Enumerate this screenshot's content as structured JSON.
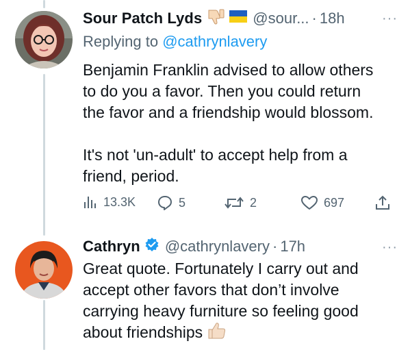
{
  "tweets": [
    {
      "author_name": "Sour Patch Lyds",
      "author_emoji": "👎",
      "author_flag": "🇺🇦",
      "handle": "@sour...",
      "separator": "·",
      "time": "18h",
      "more": "···",
      "replying_prefix": "Replying to",
      "replying_to": "@cathrynlavery",
      "text": "Benjamin Franklin advised to allow others\nto do you a favor. Then you could return\nthe favor and a friendship would blossom.\n\nIt's not 'un-adult' to accept help from a\nfriend, period.",
      "actions": {
        "views": "13.3K",
        "replies": "5",
        "retweets": "2",
        "likes": "697"
      }
    },
    {
      "author_name": "Cathryn",
      "verified": true,
      "handle": "@cathrynlavery",
      "separator": "·",
      "time": "17h",
      "more": "···",
      "text": "Great quote. Fortunately I carry out and\naccept other favors that don’t involve\ncarrying heavy furniture so feeling good\nabout friendships",
      "trailing_emoji": "👍"
    }
  ],
  "colors": {
    "text": "#0f1419",
    "muted": "#536471",
    "accent": "#1d9bf0",
    "thread_line": "#cfd9de",
    "verified_badge": "#1d9bf0",
    "avatar2_bg": "#e8571f"
  },
  "icons": {
    "views": "bar-chart-icon",
    "replies": "speech-bubble-icon",
    "retweets": "retweet-icon",
    "likes": "heart-icon",
    "share": "share-upload-icon",
    "more": "more-dots-icon"
  }
}
